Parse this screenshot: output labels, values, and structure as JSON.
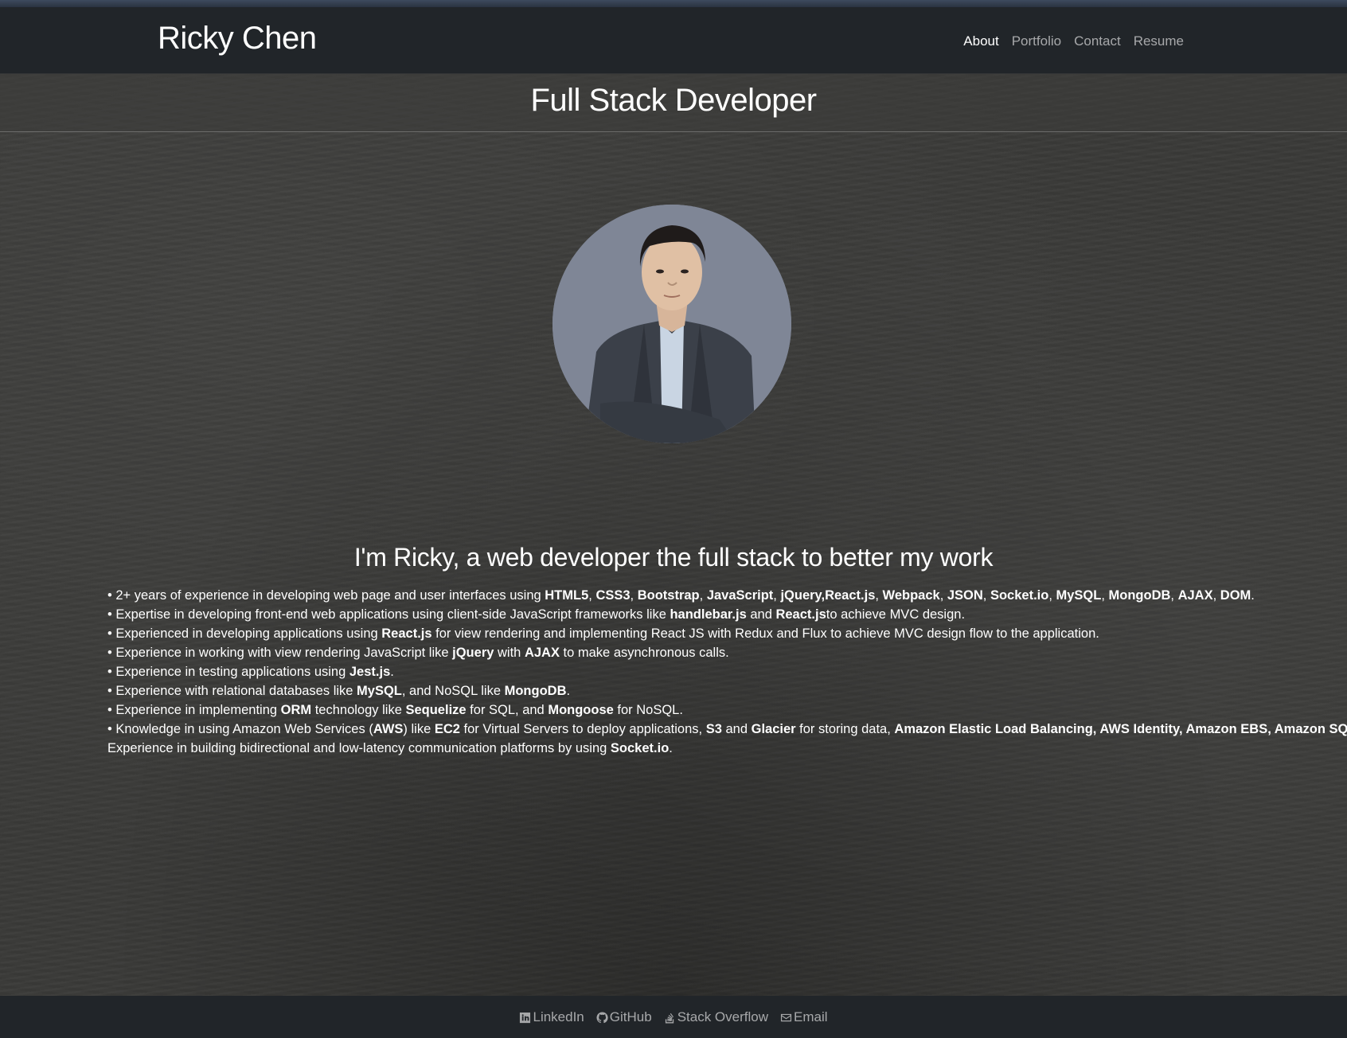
{
  "navbar": {
    "brand": "Ricky Chen",
    "links": [
      {
        "label": "About",
        "active": true
      },
      {
        "label": "Portfolio",
        "active": false
      },
      {
        "label": "Contact",
        "active": false
      },
      {
        "label": "Resume",
        "active": false
      }
    ]
  },
  "hero": {
    "title": "Full Stack Developer"
  },
  "profile": {
    "photo_icon": "profile-photo"
  },
  "about": {
    "tagline": "I'm Ricky, a web developer the full stack to better my work",
    "bullets": [
      [
        {
          "t": "• 2+ years of experience in developing web page and user interfaces using ",
          "b": false
        },
        {
          "t": "HTML5",
          "b": true
        },
        {
          "t": ", ",
          "b": false
        },
        {
          "t": "CSS3",
          "b": true
        },
        {
          "t": ", ",
          "b": false
        },
        {
          "t": "Bootstrap",
          "b": true
        },
        {
          "t": ", ",
          "b": false
        },
        {
          "t": "JavaScript",
          "b": true
        },
        {
          "t": ", ",
          "b": false
        },
        {
          "t": "jQuery,React.js",
          "b": true
        },
        {
          "t": ", ",
          "b": false
        },
        {
          "t": "Webpack",
          "b": true
        },
        {
          "t": ", ",
          "b": false
        },
        {
          "t": "JSON",
          "b": true
        },
        {
          "t": ", ",
          "b": false
        },
        {
          "t": "Socket.io",
          "b": true
        },
        {
          "t": ", ",
          "b": false
        },
        {
          "t": "MySQL",
          "b": true
        },
        {
          "t": ", ",
          "b": false
        },
        {
          "t": "MongoDB",
          "b": true
        },
        {
          "t": ", ",
          "b": false
        },
        {
          "t": "AJAX",
          "b": true
        },
        {
          "t": ", ",
          "b": false
        },
        {
          "t": "DOM",
          "b": true
        },
        {
          "t": ".",
          "b": false
        }
      ],
      [
        {
          "t": "• Expertise in developing front-end web applications using client-side JavaScript frameworks like ",
          "b": false
        },
        {
          "t": "handlebar.js",
          "b": true
        },
        {
          "t": " and ",
          "b": false
        },
        {
          "t": "React.js",
          "b": true
        },
        {
          "t": "to achieve MVC design.",
          "b": false
        }
      ],
      [
        {
          "t": "• Experienced in developing applications using ",
          "b": false
        },
        {
          "t": "React.js",
          "b": true
        },
        {
          "t": " for view rendering and implementing React JS with Redux and Flux to achieve MVC design flow to the application.",
          "b": false
        }
      ],
      [
        {
          "t": "• Experience in working with view rendering JavaScript like ",
          "b": false
        },
        {
          "t": "jQuery",
          "b": true
        },
        {
          "t": " with ",
          "b": false
        },
        {
          "t": "AJAX",
          "b": true
        },
        {
          "t": " to make asynchronous calls.",
          "b": false
        }
      ],
      [
        {
          "t": "• Experience in testing applications using ",
          "b": false
        },
        {
          "t": "Jest.js",
          "b": true
        },
        {
          "t": ".",
          "b": false
        }
      ],
      [
        {
          "t": "• Experience with relational databases like ",
          "b": false
        },
        {
          "t": "MySQL",
          "b": true
        },
        {
          "t": ", and NoSQL like ",
          "b": false
        },
        {
          "t": "MongoDB",
          "b": true
        },
        {
          "t": ".",
          "b": false
        }
      ],
      [
        {
          "t": "• Experience in implementing ",
          "b": false
        },
        {
          "t": "ORM",
          "b": true
        },
        {
          "t": " technology like ",
          "b": false
        },
        {
          "t": "Sequelize",
          "b": true
        },
        {
          "t": " for SQL, and ",
          "b": false
        },
        {
          "t": "Mongoose",
          "b": true
        },
        {
          "t": " for NoSQL.",
          "b": false
        }
      ],
      [
        {
          "t": "• Knowledge in using Amazon Web Services (",
          "b": false
        },
        {
          "t": "AWS",
          "b": true
        },
        {
          "t": ") like ",
          "b": false
        },
        {
          "t": "EC2",
          "b": true
        },
        {
          "t": " for Virtual Servers to deploy applications, ",
          "b": false
        },
        {
          "t": "S3",
          "b": true
        },
        {
          "t": " and ",
          "b": false
        },
        {
          "t": "Glacier",
          "b": true
        },
        {
          "t": " for storing data, ",
          "b": false
        },
        {
          "t": "Amazon Elastic Load Balancing, AWS Identity, Amazon EBS, Amazon SQS.",
          "b": true
        }
      ],
      [
        {
          "t": "Experience in building bidirectional and low-latency communication platforms by using ",
          "b": false
        },
        {
          "t": "Socket.io",
          "b": true
        },
        {
          "t": ".",
          "b": false
        }
      ]
    ]
  },
  "footer": {
    "links": [
      {
        "label": "LinkedIn",
        "icon": "linkedin-icon"
      },
      {
        "label": "GitHub",
        "icon": "github-icon"
      },
      {
        "label": "Stack Overflow",
        "icon": "stackoverflow-icon"
      },
      {
        "label": "Email",
        "icon": "email-icon"
      }
    ]
  }
}
